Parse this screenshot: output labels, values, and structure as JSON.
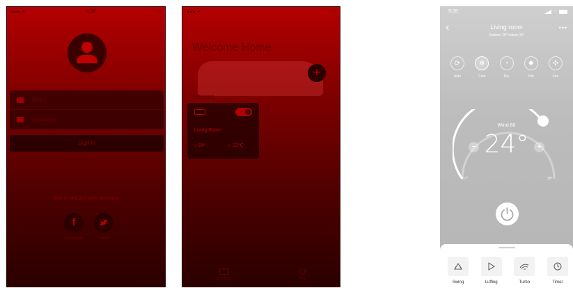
{
  "screen1": {
    "status_time": "9:38",
    "email_placeholder": "Email",
    "password_placeholder": "Password",
    "signin_label": "Sign in",
    "third_party_text": "Sign in with 3rd-party accounts",
    "facebook_glyph": "f",
    "facebook_label": "Facebook",
    "twitter_label": "Twitter"
  },
  "screen2": {
    "welcome": "Welcome Home",
    "add_glyph": "+",
    "devices_label": "Devices",
    "device_name": "Living Room",
    "indoor_temp": "24°",
    "outdoor_temp": "23°C",
    "tab_devices": "Devices",
    "tab_me": "Me"
  },
  "screen3": {
    "time": "9:28",
    "back_glyph": "‹",
    "title": "Living room",
    "subtitle": "Outdoor 28°  Indoor 26°",
    "more_glyph": "•••",
    "modes": [
      {
        "label": "Auto",
        "icon": "auto-icon",
        "glyph": "⟳"
      },
      {
        "label": "Cool",
        "icon": "snowflake-icon",
        "glyph": "❄"
      },
      {
        "label": "Dry",
        "icon": "drop-icon",
        "glyph": "◔"
      },
      {
        "label": "Hot",
        "icon": "sun-icon",
        "glyph": "✹"
      },
      {
        "label": "Fan",
        "icon": "fan-icon",
        "glyph": "✣"
      }
    ],
    "active_mode": "Cool",
    "wind": "Wind 60",
    "temperature": "24°",
    "minus_glyph": "−",
    "plus_glyph": "+",
    "min_temp": "17°",
    "max_temp": "30°",
    "functions": [
      {
        "label": "Swing",
        "icon": "swing-icon"
      },
      {
        "label": "Luffing",
        "icon": "luffing-icon"
      },
      {
        "label": "Turbo",
        "icon": "turbo-icon"
      },
      {
        "label": "Timer",
        "icon": "timer-icon"
      }
    ]
  }
}
